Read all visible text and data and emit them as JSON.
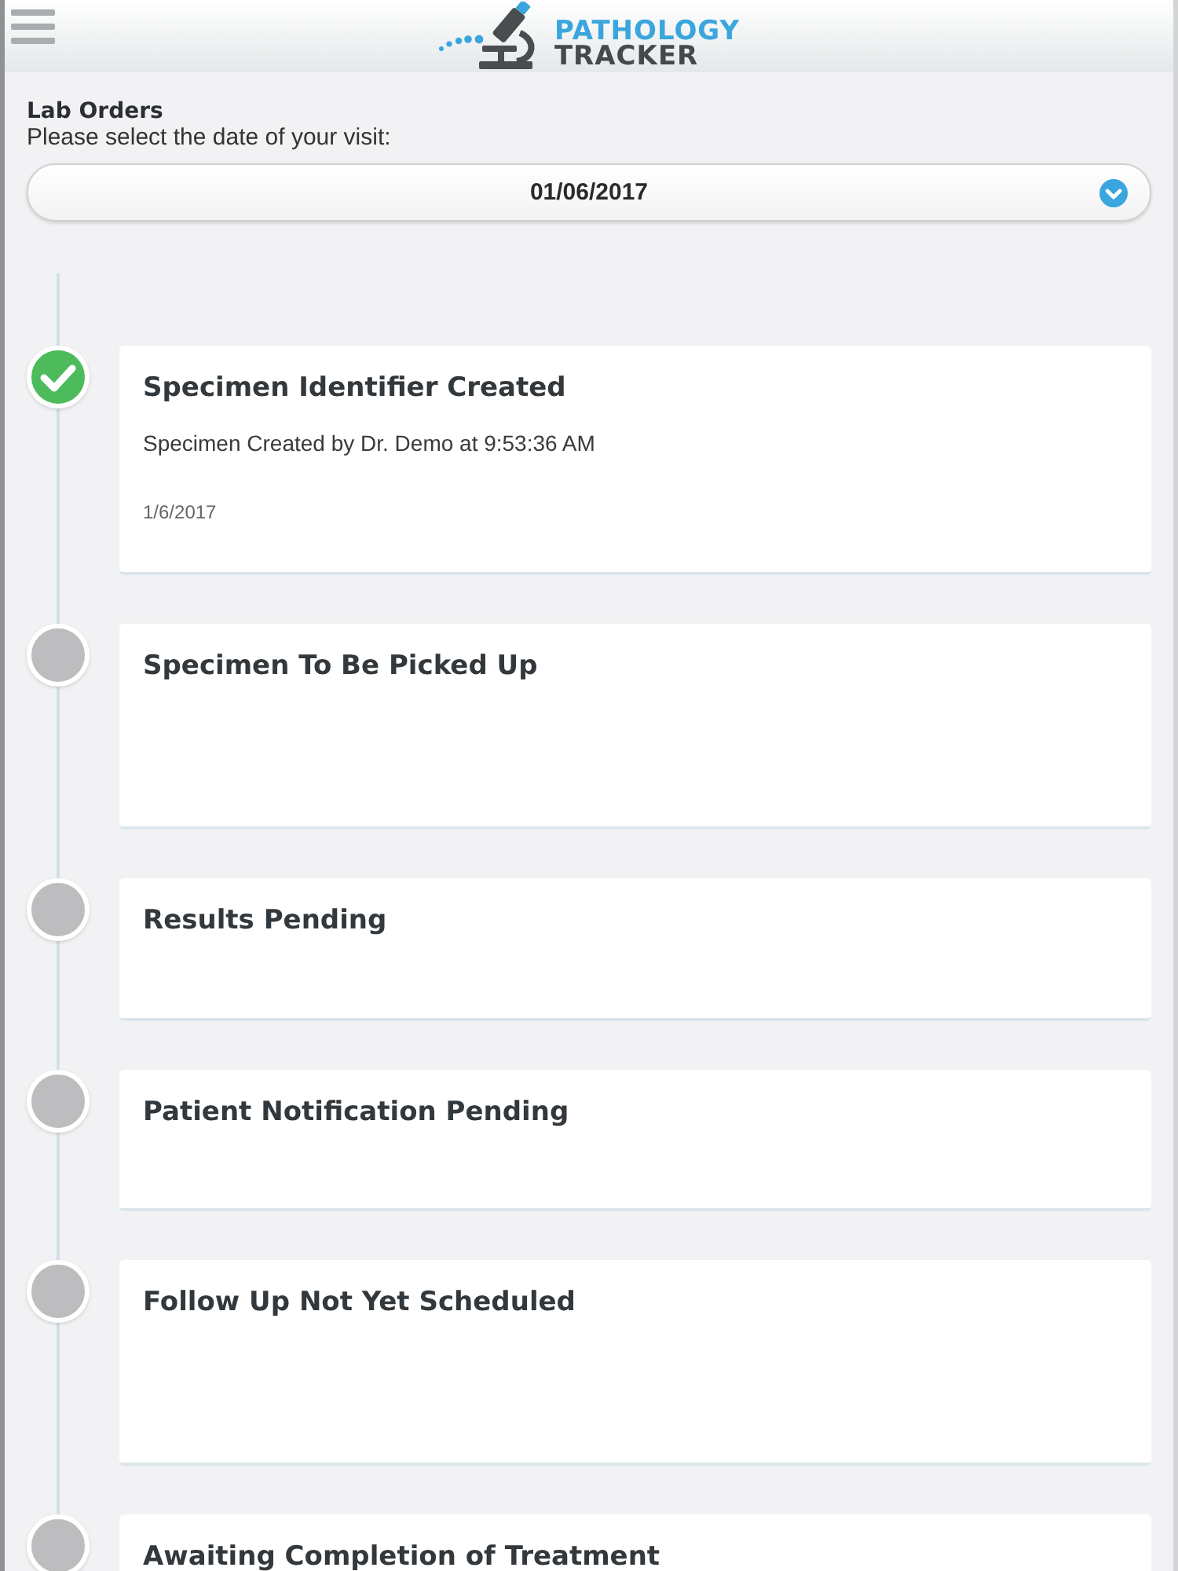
{
  "header": {
    "logo": {
      "line_1": "PATHOLOGY",
      "line_2": "TRACKER"
    }
  },
  "lab_orders": {
    "title": "Lab Orders",
    "prompt": "Please select the date of your visit:",
    "date_select": {
      "value": "01/06/2017"
    }
  },
  "timeline": [
    {
      "title": "Specimen Identifier Created",
      "done": true,
      "detail": "Specimen Created by Dr. Demo at 9:53:36 AM",
      "date": "1/6/2017"
    },
    {
      "title": "Specimen To Be Picked Up",
      "done": false
    },
    {
      "title": "Results Pending",
      "done": false
    },
    {
      "title": "Patient Notification Pending",
      "done": false
    },
    {
      "title": "Follow Up Not Yet Scheduled",
      "done": false
    },
    {
      "title": "Awaiting Completion of Treatment",
      "done": false
    }
  ]
}
